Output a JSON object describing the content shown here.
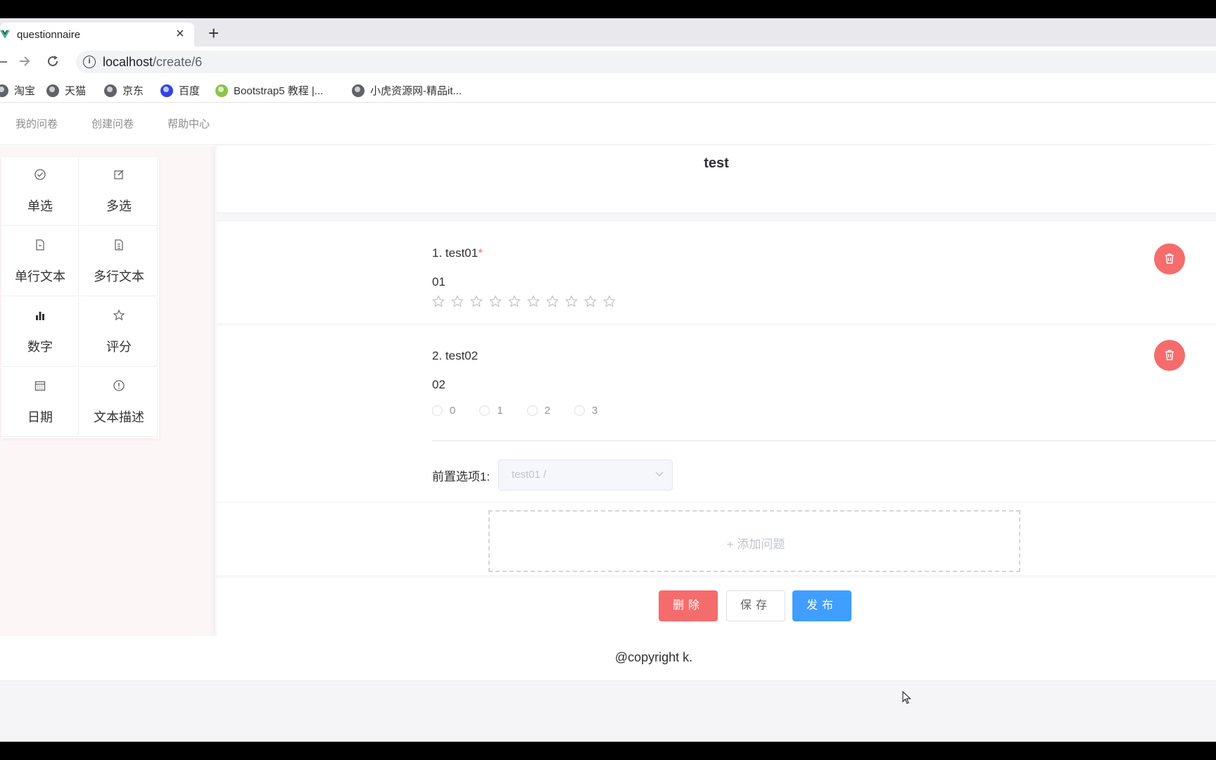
{
  "browser": {
    "tab_title": "questionnaire",
    "close_glyph": "×",
    "new_tab_glyph": "+",
    "url_host": "localhost",
    "url_path": "/create/6",
    "bookmarks": [
      "淘宝",
      "天猫",
      "京东",
      "百度",
      "Bootstrap5 教程 |...",
      "小虎资源网-精品it..."
    ]
  },
  "nav": {
    "items": [
      "我的问卷",
      "创建问卷",
      "帮助中心"
    ]
  },
  "palette": {
    "items": [
      {
        "label": "单选",
        "icon": "check-circle-icon"
      },
      {
        "label": "多选",
        "icon": "edit-icon"
      },
      {
        "label": "单行文本",
        "icon": "document-icon"
      },
      {
        "label": "多行文本",
        "icon": "document-lines-icon"
      },
      {
        "label": "数字",
        "icon": "bar-chart-icon"
      },
      {
        "label": "评分",
        "icon": "star-icon"
      },
      {
        "label": "日期",
        "icon": "calendar-icon"
      },
      {
        "label": "文本描述",
        "icon": "info-icon"
      }
    ]
  },
  "survey": {
    "title": "test",
    "questions": [
      {
        "number_title": "1. test01",
        "required_mark": "*",
        "description": "01",
        "type": "rating",
        "star_count": 10
      },
      {
        "number_title": "2. test02",
        "description": "02",
        "type": "radio",
        "options": [
          "0",
          "1",
          "2",
          "3"
        ]
      }
    ],
    "precondition": {
      "label": "前置选项1:",
      "value": "test01 /"
    },
    "add_question": "+ 添加问题"
  },
  "actions": {
    "delete": "删除",
    "save": "保存",
    "publish": "发布"
  },
  "footer": {
    "text": "@copyright k."
  },
  "colors": {
    "danger": "#f56c6c",
    "primary": "#409eff"
  }
}
